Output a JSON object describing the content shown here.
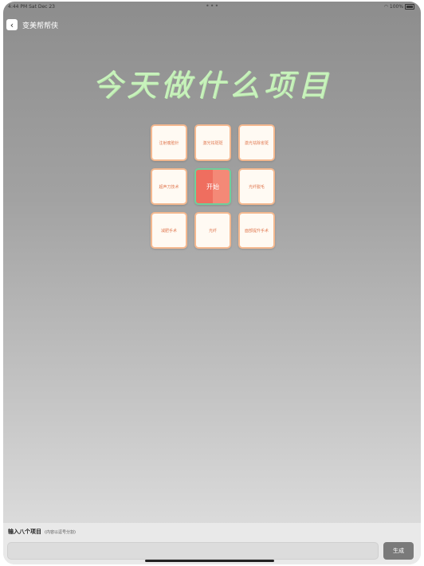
{
  "status_bar": {
    "time_date": "4:44 PM  Sat Dec 23",
    "battery": "100%"
  },
  "nav": {
    "title": "变美帮帮侠"
  },
  "headline": "今天做什么项目",
  "grid": {
    "start_label": "开始",
    "items": [
      "注射瘦脸针",
      "激光祛斑斑",
      "激光祛除雀斑",
      "超声刀技术",
      "光纤脱毛",
      "减肥手术",
      "光纤",
      "面部提升手术"
    ]
  },
  "bottom": {
    "label": "输入八个项目",
    "hint": "(内容以逗号分割)",
    "input_value": "",
    "generate_label": "生成"
  }
}
